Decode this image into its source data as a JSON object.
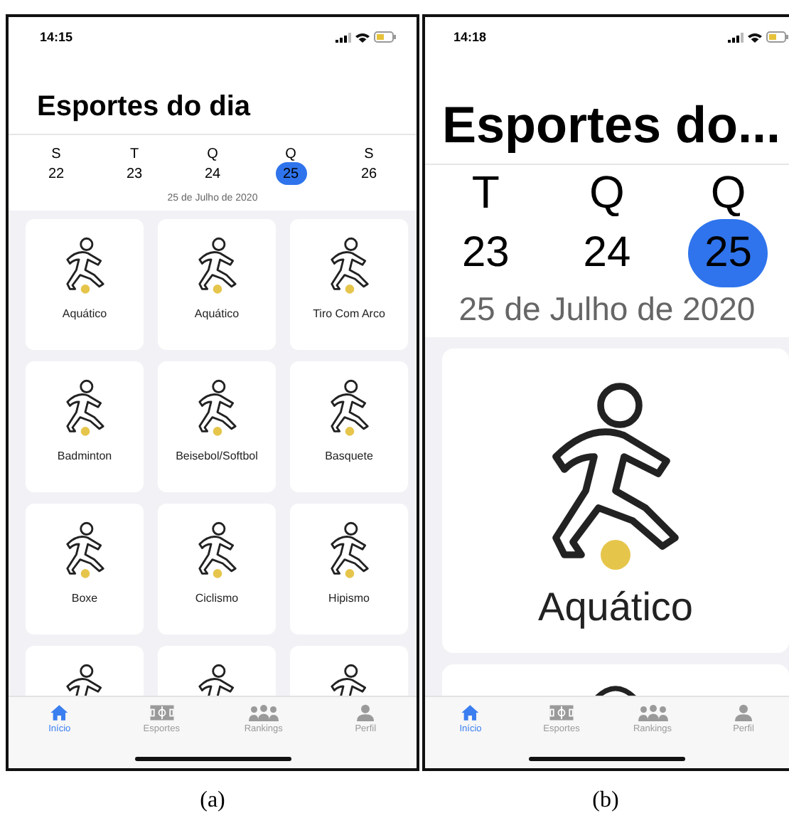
{
  "panels": [
    {
      "caption": "(a)",
      "kind": "grid",
      "status_time": "14:15",
      "title": "Esportes do dia",
      "days": [
        {
          "letter": "S",
          "number": "22",
          "selected": false
        },
        {
          "letter": "T",
          "number": "23",
          "selected": false
        },
        {
          "letter": "Q",
          "number": "24",
          "selected": false
        },
        {
          "letter": "Q",
          "number": "25",
          "selected": true
        },
        {
          "letter": "S",
          "number": "26",
          "selected": false
        }
      ],
      "date_label": "25 de Julho de 2020",
      "cards": [
        {
          "label": "Aquático"
        },
        {
          "label": "Aquático"
        },
        {
          "label": "Tiro Com Arco"
        },
        {
          "label": "Badminton"
        },
        {
          "label": "Beisebol/Softbol"
        },
        {
          "label": "Basquete"
        },
        {
          "label": "Boxe"
        },
        {
          "label": "Ciclismo"
        },
        {
          "label": "Hipismo"
        },
        {
          "kind": "partial"
        },
        {
          "kind": "partial"
        },
        {
          "kind": "partial"
        }
      ],
      "tabs": [
        {
          "label": "Início",
          "selected": true
        },
        {
          "label": "Esportes",
          "selected": false
        },
        {
          "label": "Rankings",
          "selected": false
        },
        {
          "label": "Perfil",
          "selected": false
        }
      ]
    },
    {
      "caption": "(b)",
      "kind": "zoomed",
      "status_time": "14:18",
      "title": "Esportes do...",
      "days": [
        {
          "letter": "T",
          "number": "23",
          "selected": false
        },
        {
          "letter": "Q",
          "number": "24",
          "selected": false
        },
        {
          "letter": "Q",
          "number": "25",
          "selected": true
        }
      ],
      "date_label": "25 de Julho de 2020",
      "cards": [
        {
          "label": "Aquático"
        },
        {
          "kind": "partial"
        }
      ],
      "tabs": [
        {
          "label": "Início",
          "selected": true
        },
        {
          "label": "Esportes",
          "selected": false
        },
        {
          "label": "Rankings",
          "selected": false
        },
        {
          "label": "Perfil",
          "selected": false
        }
      ]
    }
  ]
}
